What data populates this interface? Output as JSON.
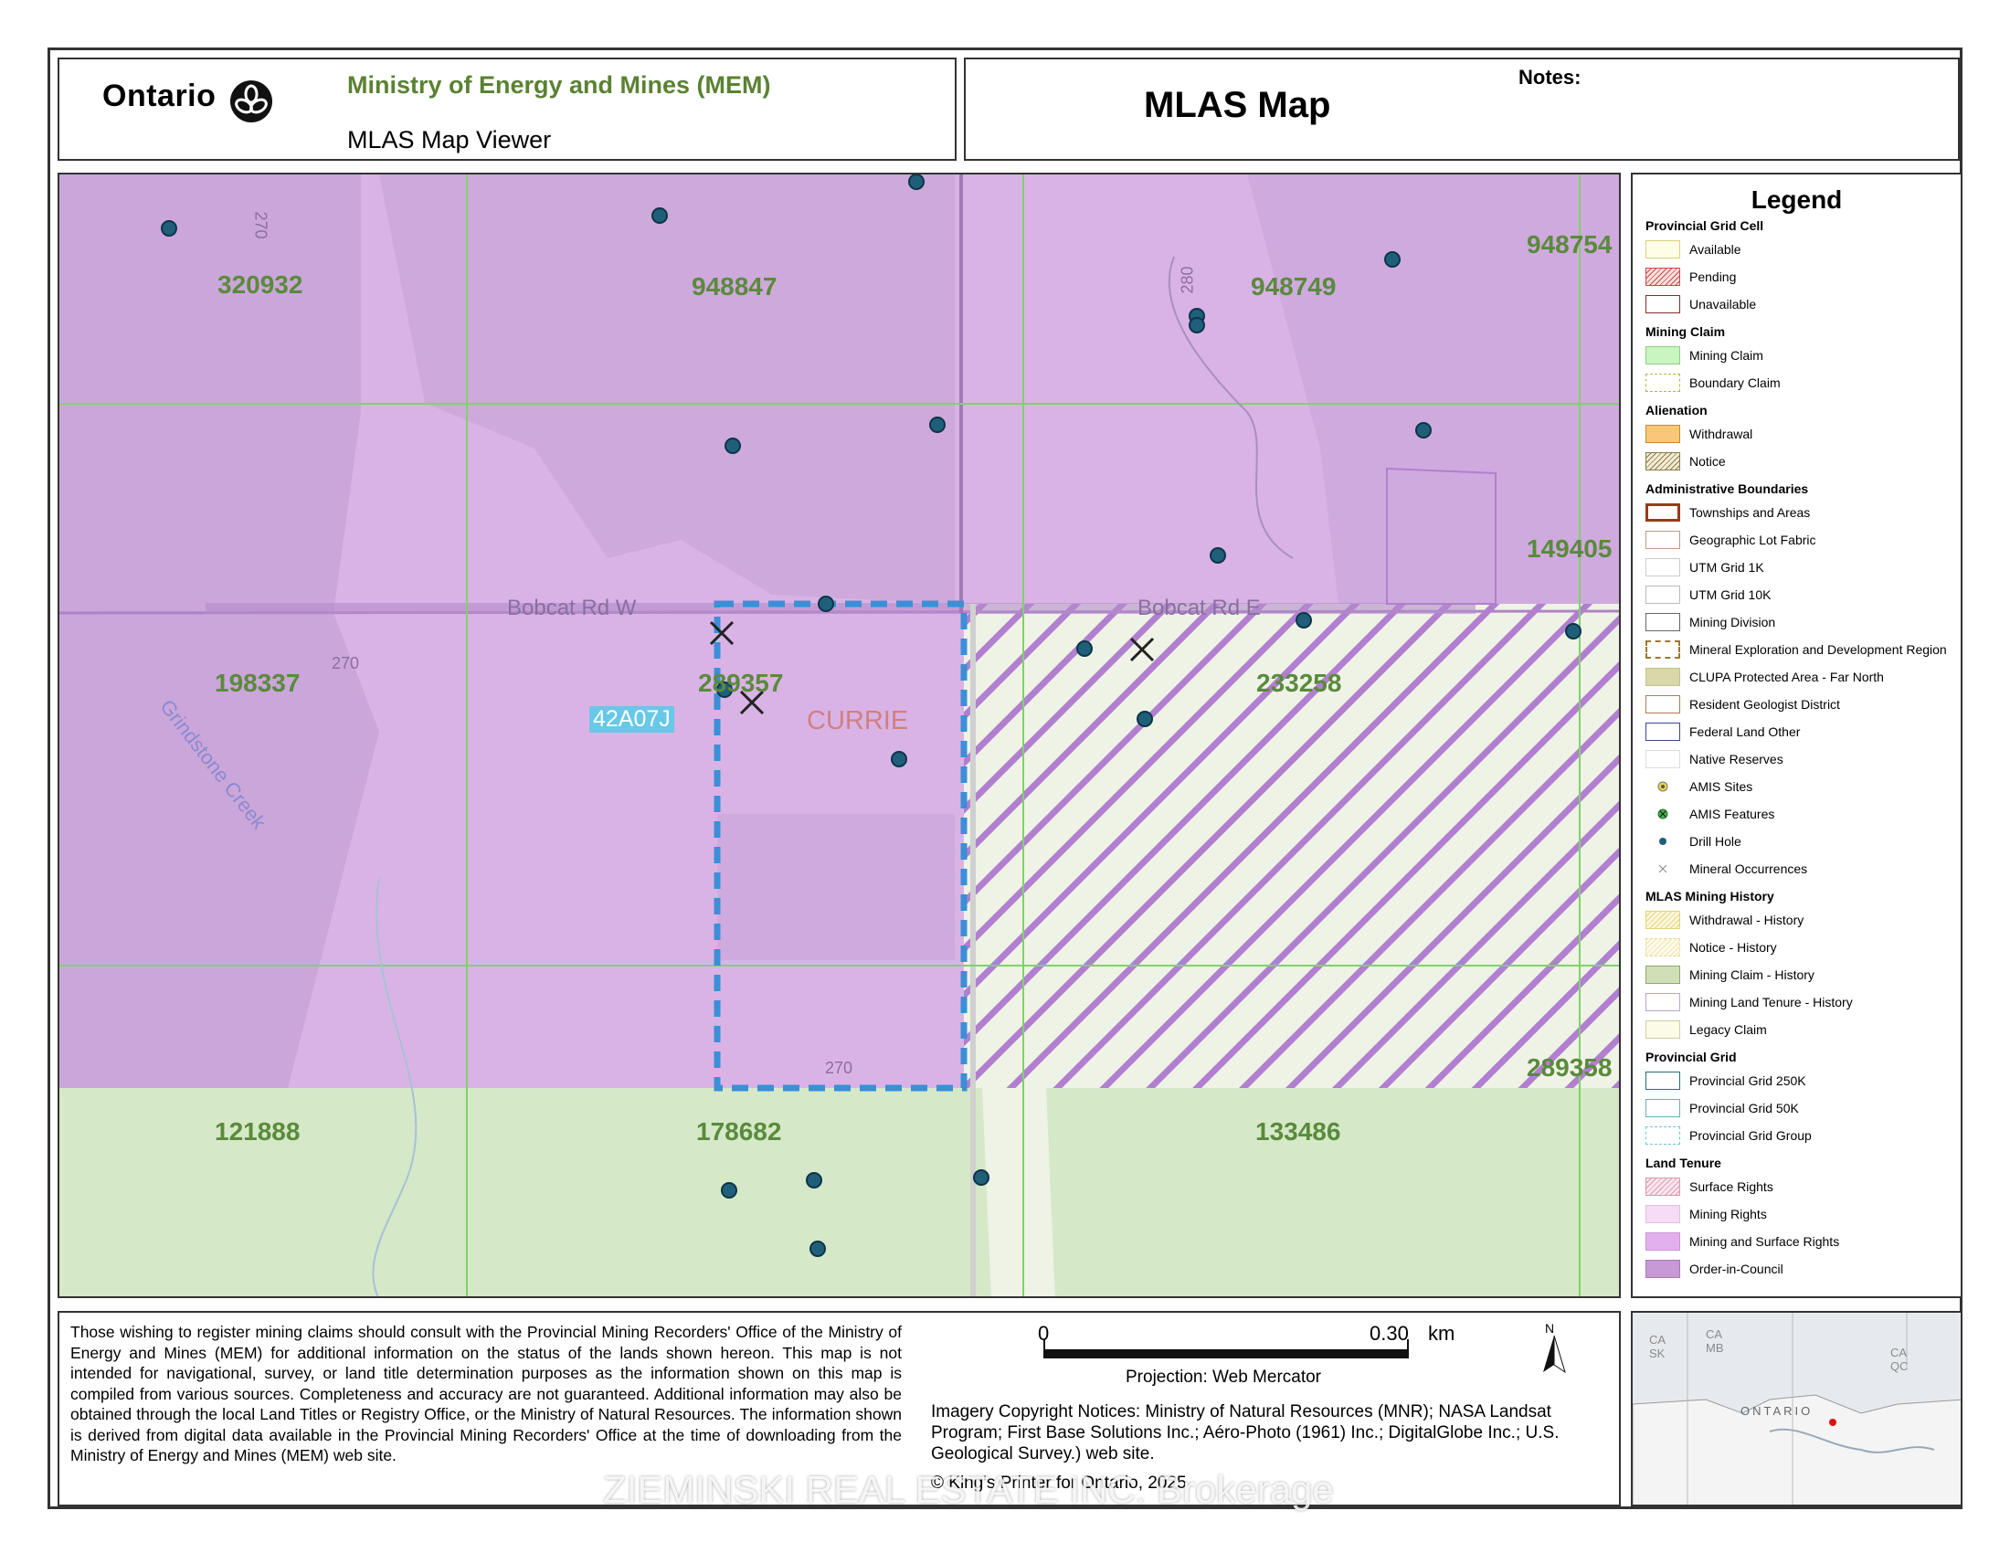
{
  "header": {
    "ontario_logo_text": "Ontario",
    "ministry": "Ministry of Energy and Mines (MEM)",
    "viewer": "MLAS Map Viewer",
    "map_title": "MLAS Map",
    "notes_label": "Notes:"
  },
  "map": {
    "cell_labels": [
      "320932",
      "948847",
      "948749",
      "948754",
      "149405",
      "198337",
      "289357",
      "233258",
      "289358",
      "121888",
      "178682",
      "133486"
    ],
    "road_labels": [
      "Bobcat Rd W",
      "Bobcat Rd E"
    ],
    "creek_label": "Grindstone Creek",
    "area_label": "CURRIE",
    "grid_label": "42A07J",
    "contour_labels": [
      "270",
      "280",
      "270",
      "270"
    ],
    "colors": {
      "mining_and_surface_rights": "#d9b3e6",
      "history_green": "#d5e8c7",
      "selected_boundary": "#3b8fd6",
      "drill_hole": "#1f5f7a",
      "grid_line": "#7fd26a"
    }
  },
  "legend": {
    "title": "Legend",
    "groups": [
      {
        "title": "Provincial Grid Cell",
        "items": [
          {
            "label": "Available",
            "swatch": "outline-yellow"
          },
          {
            "label": "Pending",
            "swatch": "hatch-red"
          },
          {
            "label": "Unavailable",
            "swatch": "outline-darkred"
          }
        ]
      },
      {
        "title": "Mining Claim",
        "items": [
          {
            "label": "Mining Claim",
            "swatch": "fill-lightgreen"
          },
          {
            "label": "Boundary Claim",
            "swatch": "dashed-olive"
          }
        ]
      },
      {
        "title": "Alienation",
        "items": [
          {
            "label": "Withdrawal",
            "swatch": "fill-orange"
          },
          {
            "label": "Notice",
            "swatch": "hatch-olive"
          }
        ]
      },
      {
        "title": "Administrative Boundaries",
        "items": [
          {
            "label": "Townships and Areas",
            "swatch": "thick-brown"
          },
          {
            "label": "Geographic Lot Fabric",
            "swatch": "outline-tan"
          },
          {
            "label": "UTM Grid 1K",
            "swatch": "outline-lightgrey"
          },
          {
            "label": "UTM Grid 10K",
            "swatch": "outline-grey"
          },
          {
            "label": "Mining Division",
            "swatch": "outline-darkgrey"
          },
          {
            "label": "Mineral Exploration and Development Region",
            "swatch": "dashed-brown"
          },
          {
            "label": "CLUPA Protected Area - Far North",
            "swatch": "fill-khaki"
          },
          {
            "label": "Resident Geologist District",
            "swatch": "outline-sienna"
          },
          {
            "label": "Federal Land Other",
            "swatch": "outline-navy"
          },
          {
            "label": "Native Reserves",
            "swatch": "outline-silver"
          },
          {
            "label": "AMIS Sites",
            "swatch": "symbol-amis-site"
          },
          {
            "label": "AMIS Features",
            "swatch": "symbol-amis-feature"
          },
          {
            "label": "Drill Hole",
            "swatch": "symbol-drill-hole"
          },
          {
            "label": "Mineral Occurrences",
            "swatch": "symbol-occurrence"
          }
        ]
      },
      {
        "title": "MLAS Mining History",
        "items": [
          {
            "label": "Withdrawal - History",
            "swatch": "hatch-yellow"
          },
          {
            "label": "Notice - History",
            "swatch": "hatch-paleyellow"
          },
          {
            "label": "Mining Claim - History",
            "swatch": "fill-sagegreen"
          },
          {
            "label": "Mining Land Tenure - History",
            "swatch": "outline-lavender"
          },
          {
            "label": "Legacy Claim",
            "swatch": "fill-ivory"
          }
        ]
      },
      {
        "title": "Provincial Grid",
        "items": [
          {
            "label": "Provincial Grid 250K",
            "swatch": "outline-teal"
          },
          {
            "label": "Provincial Grid 50K",
            "swatch": "outline-lightteal"
          },
          {
            "label": "Provincial Grid Group",
            "swatch": "dashed-teal"
          }
        ]
      },
      {
        "title": "Land Tenure",
        "items": [
          {
            "label": "Surface Rights",
            "swatch": "hatch-pink"
          },
          {
            "label": "Mining Rights",
            "swatch": "fill-palepink"
          },
          {
            "label": "Mining and Surface Rights",
            "swatch": "fill-violet"
          },
          {
            "label": "Order-in-Council",
            "swatch": "fill-purple"
          }
        ]
      }
    ]
  },
  "footer": {
    "disclaimer": "Those wishing to register mining claims should consult with the Provincial Mining Recorders' Office of the Ministry of Energy and Mines (MEM) for additional information on the status of the lands shown hereon. This map is not intended for navigational, survey, or land title determination purposes as the information shown on this map is compiled from various sources. Completeness and accuracy are not guaranteed. Additional information may also be obtained through the local Land Titles or Registry Office, or the Ministry of Natural Resources. The information shown is derived from digital data available in the Provincial Mining Recorders' Office at the time of downloading from the Ministry of Energy and Mines (MEM) web site.",
    "scale_start": "0",
    "scale_end": "0.30",
    "scale_unit": "km",
    "north_letter": "N",
    "projection": "Projection: Web Mercator",
    "imagery": "Imagery Copyright Notices: Ministry of Natural Resources (MNR); NASA Landsat Program; First Base Solutions Inc.; Aéro-Photo (1961) Inc.; DigitalGlobe Inc.; U.S. Geological Survey.) web site.",
    "copyright": "© King's Printer for Ontario, 2025",
    "watermark": "ZIEMINSKI REAL ESTATE INC. Brokerage"
  },
  "inset": {
    "labels": [
      "CA SK",
      "CA MB",
      "CA QC",
      "ONTARIO"
    ]
  }
}
